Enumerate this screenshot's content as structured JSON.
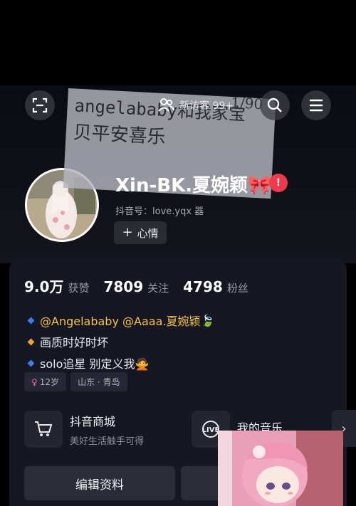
{
  "header": {
    "visitor_text": "新访客 99+",
    "sticker_line1": "angelababy和我家宝",
    "sticker_line2": "贝平安喜乐",
    "sticker_counter": "1/90"
  },
  "profile": {
    "nickname": "Xin-BK.夏婉颖🎀",
    "badge": "!",
    "douyin_id": "抖音号：love.yqx 器",
    "mood_label": "心情"
  },
  "stats": [
    {
      "num": "9.0万",
      "label": "获赞"
    },
    {
      "num": "7809",
      "label": "关注"
    },
    {
      "num": "4798",
      "label": "粉丝"
    }
  ],
  "bio": {
    "line1_link": "@Angelababy @Aaaa.夏婉颖",
    "line1_extra": "🍃",
    "line2": "画质时好时坏",
    "line3": "solo追星 别定义我🙅"
  },
  "tags": [
    {
      "text": "12岁",
      "icon": "female"
    },
    {
      "text": "山东 · 青岛",
      "icon": ""
    }
  ],
  "services": {
    "shop_title": "抖音商城",
    "shop_sub": "美好生活触手可得",
    "music_title": "我的音乐",
    "music_sub": "",
    "more": "›"
  },
  "edit_label": "编辑资料",
  "colors": {
    "accent_red": "#f2394b",
    "bio_blue": "#3f7cf4",
    "bio_orange": "#f0a030",
    "gold": "#f2c24b"
  }
}
